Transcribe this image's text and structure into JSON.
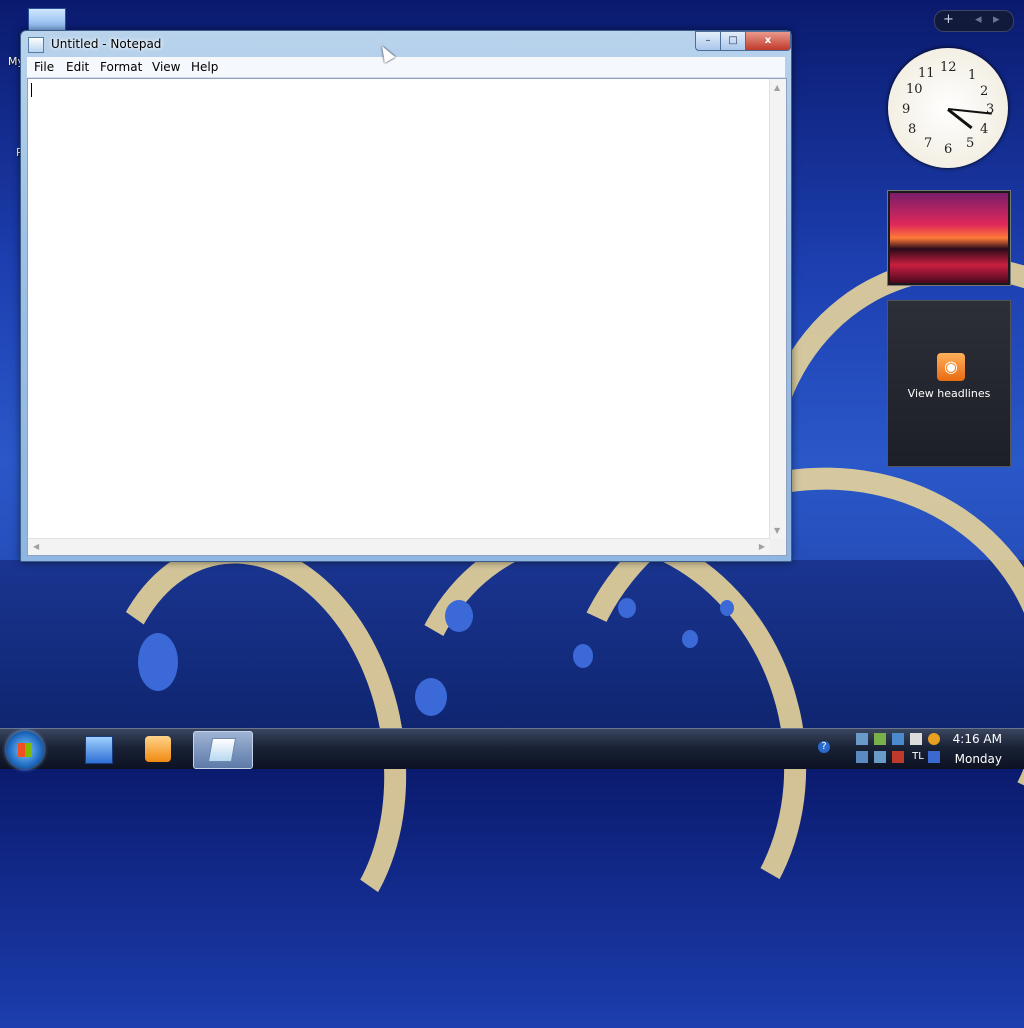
{
  "desktop": {
    "icon_label_1": "My",
    "icon_label_2": "R"
  },
  "notepad": {
    "title": "Untitled - Notepad",
    "menu": [
      "File",
      "Edit",
      "Format",
      "View",
      "Help"
    ],
    "content": "",
    "buttons": {
      "minimize": "–",
      "maximize": "□",
      "close": "x"
    }
  },
  "sidebar": {
    "add_label": "+",
    "prev_label": "◂",
    "next_label": "▸",
    "clock_numbers": [
      "12",
      "1",
      "2",
      "3",
      "4",
      "5",
      "6",
      "7",
      "8",
      "9",
      "10",
      "11"
    ],
    "feed_label": "View headlines",
    "feed_icon": "rss-icon"
  },
  "taskbar": {
    "time": "4:16 AM",
    "day": "Monday",
    "help_icon": "?",
    "tray_lang": "TL"
  },
  "colors": {
    "accent": "#1f6ac0",
    "close_red": "#c0392b",
    "rss_orange": "#e86a10"
  }
}
